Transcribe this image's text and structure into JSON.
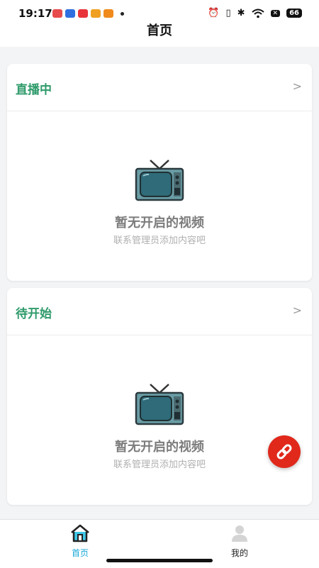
{
  "status_bar": {
    "time": "19:17",
    "battery": "66",
    "app_icon_colors": [
      "#e84b4b",
      "#2f6fe0",
      "#e8353b",
      "#f0a020",
      "#f08a1a"
    ]
  },
  "header": {
    "title": "首页"
  },
  "sections": [
    {
      "title": "直播中",
      "chevron": ">",
      "empty_title": "暂无开启的视频",
      "empty_subtitle": "联系管理员添加内容吧"
    },
    {
      "title": "待开始",
      "chevron": ">",
      "empty_title": "暂无开启的视频",
      "empty_subtitle": "联系管理员添加内容吧"
    }
  ],
  "tab_bar": {
    "tabs": [
      {
        "label": "首页",
        "icon": "home-icon",
        "active": true
      },
      {
        "label": "我的",
        "icon": "user-icon",
        "active": false
      }
    ]
  },
  "colors": {
    "accent_green": "#2e9a6a",
    "tab_active": "#18a8d8",
    "fab_red": "#e0281b"
  }
}
